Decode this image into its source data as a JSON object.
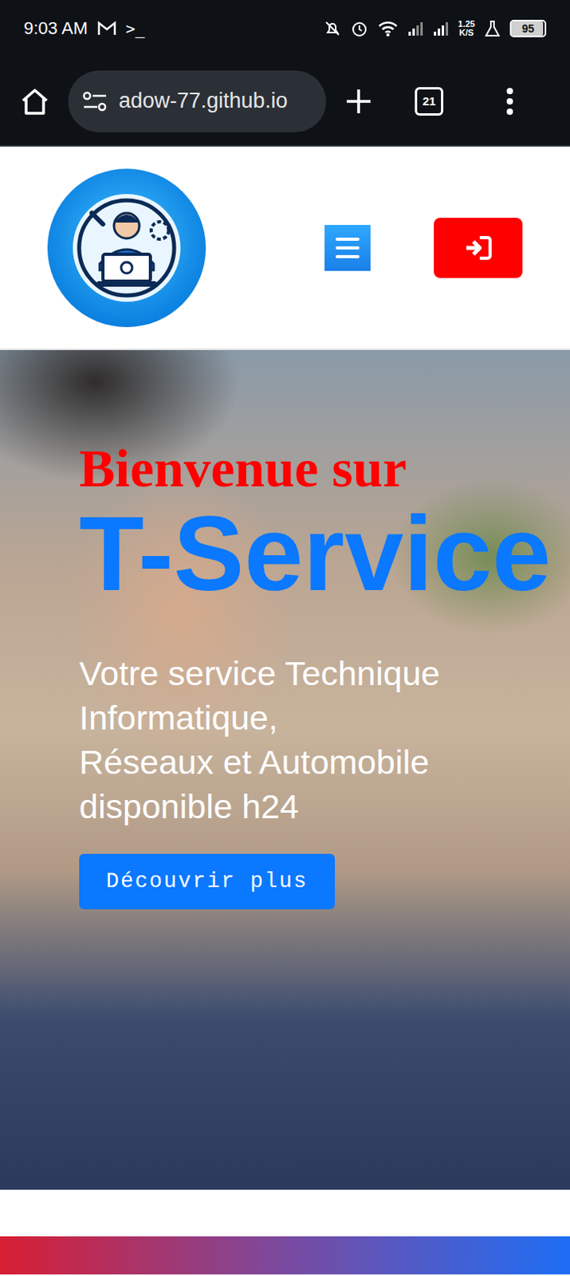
{
  "status_bar": {
    "time": "9:03 AM",
    "notification_text": ">_",
    "network_speed": "1.25",
    "network_unit": "K/S",
    "battery": "95",
    "battery_level": 0.95
  },
  "browser": {
    "url": "adow-77.github.io",
    "tab_count": "21"
  },
  "hero": {
    "greeting": "Bienvenue sur",
    "title": "T-Service",
    "subtitle_lines": [
      "Votre service Technique",
      "Informatique,",
      "Réseaux et Automobile",
      "disponible h24"
    ],
    "button": "Découvrir plus"
  }
}
